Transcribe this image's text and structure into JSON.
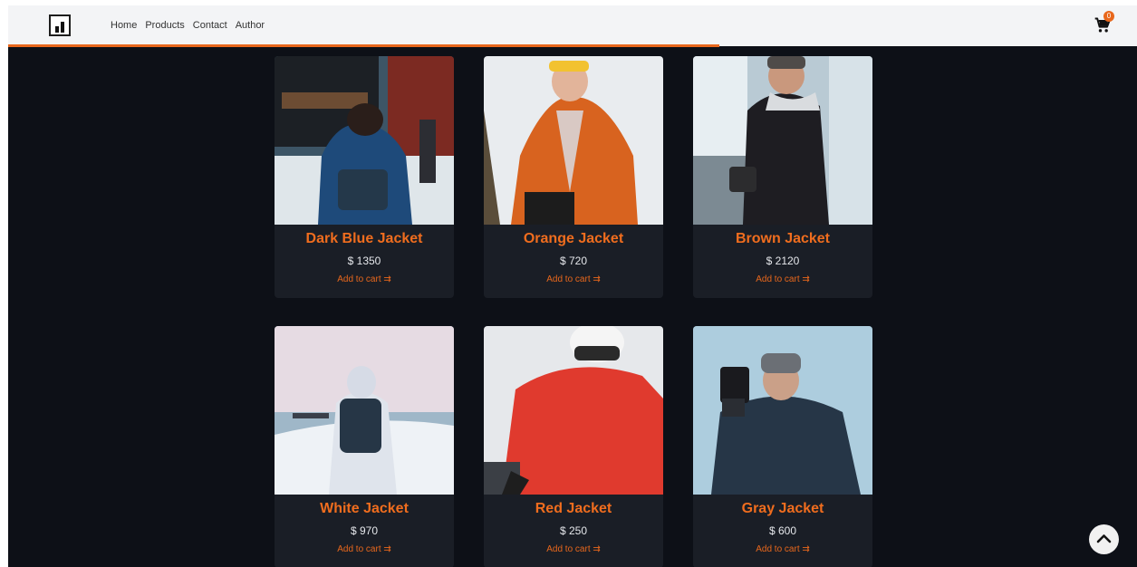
{
  "nav": {
    "links": [
      "Home",
      "Products",
      "Contact",
      "Author"
    ],
    "cart_count": "0",
    "scroll_progress": 0.63
  },
  "products": [
    {
      "name": "Dark Blue Jacket",
      "price": "$ 1350",
      "cta": "Add to cart ⇉"
    },
    {
      "name": "Orange Jacket",
      "price": "$ 720",
      "cta": "Add to cart ⇉"
    },
    {
      "name": "Brown Jacket",
      "price": "$ 2120",
      "cta": "Add to cart ⇉"
    },
    {
      "name": "White Jacket",
      "price": "$ 970",
      "cta": "Add to cart ⇉"
    },
    {
      "name": "Red Jacket",
      "price": "$ 250",
      "cta": "Add to cart ⇉"
    },
    {
      "name": "Gray Jacket",
      "price": "$ 600",
      "cta": "Add to cart ⇉"
    }
  ],
  "colors": {
    "accent": "#e8671c",
    "background": "#0d1017",
    "card": "#1a1e26",
    "navbar": "#f3f4f6"
  },
  "icons": [
    "logo-bar-chart-icon",
    "cart-icon",
    "chevron-up-icon"
  ]
}
